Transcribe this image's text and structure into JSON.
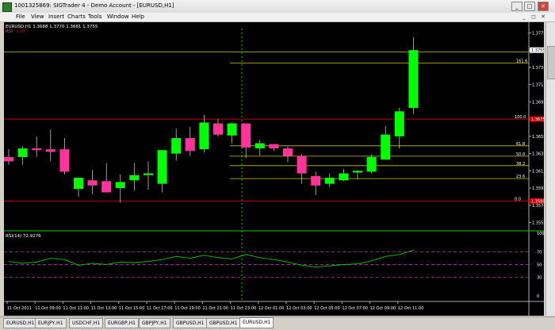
{
  "window": {
    "title": "1001325869: SIGTrader 4 - Demo Account - [EURUSD,H1]",
    "min_label": "_",
    "max_label": "□",
    "close_label": "✕"
  },
  "menu": {
    "items": [
      "File",
      "View",
      "Insert",
      "Charts",
      "Tools",
      "Window",
      "Help"
    ]
  },
  "mdi_controls": [
    "_",
    "◻",
    "✕"
  ],
  "chart": {
    "header_text": "EURUSD,H1  1.3688 1.3770 1.3681 1.3755",
    "indicator_label": "RSI",
    "indicator_value": "100",
    "rsi_label": "RSI(14) 72.9276",
    "colors": {
      "bull": "#00ff00",
      "bear": "#ff3399",
      "fib": "#c8c800",
      "level": "#c00000",
      "grid_text": "#ffffff",
      "rsi": "#00cc00",
      "rsi_level": "#cc33cc",
      "separator": "#00cc00"
    }
  },
  "chart_data": {
    "type": "candlestick",
    "symbol": "EURUSD",
    "timeframe": "H1",
    "price_axis_ticks": [
      "1.3775",
      "1.3755",
      "1.3735",
      "1.3715",
      "1.3695",
      "1.3675",
      "1.3655",
      "1.3635",
      "1.3615",
      "1.3595",
      "1.3575",
      "1.3555"
    ],
    "price_range": [
      1.355,
      1.378
    ],
    "current_price": "1.3755",
    "level_labels": {
      "upper": "1.3675",
      "lower": "1.3580"
    },
    "levels": [
      {
        "label": "100.0",
        "price": 1.3675
      },
      {
        "label": "0.0",
        "price": 1.358
      }
    ],
    "fibonacci": [
      {
        "label": "161.6",
        "price": 1.374
      },
      {
        "label": "61.8",
        "price": 1.3644
      },
      {
        "label": "50.0",
        "price": 1.3632
      },
      {
        "label": "38.2",
        "price": 1.3621
      },
      {
        "label": "23.6",
        "price": 1.3606
      }
    ],
    "rsi": {
      "range": [
        0,
        100
      ],
      "ticks": [
        "100",
        "70",
        "50",
        "30",
        "0"
      ],
      "levels": [
        70,
        50,
        30
      ],
      "current": 72.9276
    },
    "time_ticks": [
      "11 Oct 2011",
      "11 Oct 09:00",
      "11 Oct 11:00",
      "11 Oct 13:00",
      "11 Oct 15:00",
      "11 Oct 17:00",
      "11 Oct 19:00",
      "11 Oct 21:00",
      "11 Oct 23:00",
      "12 Oct 01:00",
      "12 Oct 03:00",
      "12 Oct 05:00",
      "12 Oct 07:00",
      "12 Oct 09:00",
      "12 Oct 11:00"
    ],
    "candles": [
      {
        "o": 1.3631,
        "h": 1.364,
        "l": 1.3622,
        "c": 1.3626
      },
      {
        "o": 1.3631,
        "h": 1.3643,
        "l": 1.3622,
        "c": 1.3641
      },
      {
        "o": 1.3641,
        "h": 1.3655,
        "l": 1.3631,
        "c": 1.3639
      },
      {
        "o": 1.364,
        "h": 1.3663,
        "l": 1.3626,
        "c": 1.3637
      },
      {
        "o": 1.364,
        "h": 1.3653,
        "l": 1.3611,
        "c": 1.3614
      },
      {
        "o": 1.3594,
        "h": 1.3606,
        "l": 1.3585,
        "c": 1.3607
      },
      {
        "o": 1.3604,
        "h": 1.3616,
        "l": 1.3588,
        "c": 1.3598
      },
      {
        "o": 1.3603,
        "h": 1.3624,
        "l": 1.3592,
        "c": 1.359
      },
      {
        "o": 1.3595,
        "h": 1.3611,
        "l": 1.3578,
        "c": 1.3602
      },
      {
        "o": 1.3604,
        "h": 1.3624,
        "l": 1.3592,
        "c": 1.361
      },
      {
        "o": 1.361,
        "h": 1.3626,
        "l": 1.3593,
        "c": 1.3612
      },
      {
        "o": 1.36,
        "h": 1.3639,
        "l": 1.359,
        "c": 1.3639
      },
      {
        "o": 1.3635,
        "h": 1.3664,
        "l": 1.3627,
        "c": 1.3653
      },
      {
        "o": 1.3653,
        "h": 1.3666,
        "l": 1.3632,
        "c": 1.3638
      },
      {
        "o": 1.364,
        "h": 1.368,
        "l": 1.3636,
        "c": 1.3671
      },
      {
        "o": 1.367,
        "h": 1.3675,
        "l": 1.3655,
        "c": 1.3657
      },
      {
        "o": 1.3656,
        "h": 1.3671,
        "l": 1.3647,
        "c": 1.367
      },
      {
        "o": 1.367,
        "h": 1.367,
        "l": 1.363,
        "c": 1.3642
      },
      {
        "o": 1.3641,
        "h": 1.3651,
        "l": 1.3633,
        "c": 1.3647
      },
      {
        "o": 1.3646,
        "h": 1.3644,
        "l": 1.3638,
        "c": 1.3641
      },
      {
        "o": 1.3641,
        "h": 1.3643,
        "l": 1.3625,
        "c": 1.3632
      },
      {
        "o": 1.3632,
        "h": 1.3634,
        "l": 1.36,
        "c": 1.3612
      },
      {
        "o": 1.3609,
        "h": 1.3614,
        "l": 1.3587,
        "c": 1.3598
      },
      {
        "o": 1.36,
        "h": 1.3612,
        "l": 1.3596,
        "c": 1.3607
      },
      {
        "o": 1.3604,
        "h": 1.3617,
        "l": 1.3603,
        "c": 1.3612
      },
      {
        "o": 1.3613,
        "h": 1.3616,
        "l": 1.3605,
        "c": 1.3615
      },
      {
        "o": 1.3614,
        "h": 1.3634,
        "l": 1.3612,
        "c": 1.3631
      },
      {
        "o": 1.3628,
        "h": 1.3667,
        "l": 1.3633,
        "c": 1.3657
      },
      {
        "o": 1.3655,
        "h": 1.3688,
        "l": 1.3641,
        "c": 1.3684
      },
      {
        "o": 1.3688,
        "h": 1.377,
        "l": 1.3681,
        "c": 1.3755
      }
    ],
    "rsi_series": [
      55,
      52,
      54,
      60,
      58,
      49,
      52,
      50,
      54,
      53,
      55,
      58,
      63,
      60,
      65,
      61,
      59,
      66,
      61,
      58,
      54,
      49,
      46,
      48,
      50,
      51,
      56,
      63,
      66,
      73
    ]
  },
  "tabs": [
    "EURUSD,H1",
    "EURJPY,H1",
    "USDCHF,H1",
    "EURGBP,H1",
    "GBPJPY,H1",
    "GBPUSD,H1",
    "GBPUSD,H1",
    "EURUSD,H1"
  ],
  "active_tab": 7
}
